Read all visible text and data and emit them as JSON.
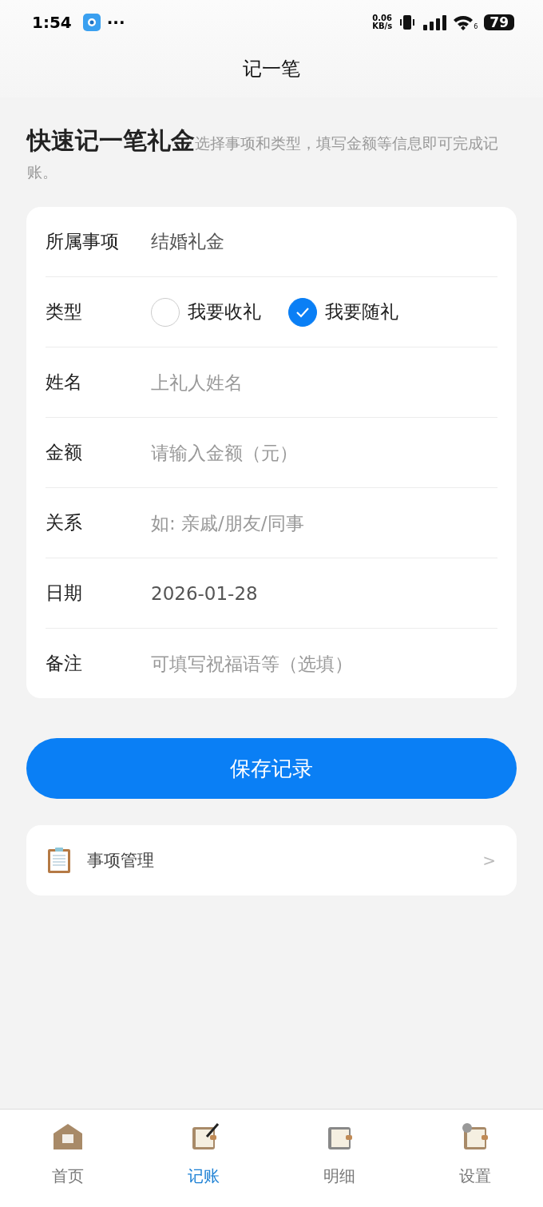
{
  "status_bar": {
    "time": "1:54",
    "more": "···",
    "net_speed": "0.06",
    "net_unit": "KB/s",
    "wifi_band": "6",
    "battery": "79"
  },
  "nav": {
    "title": "记一笔"
  },
  "intro": {
    "title": "快速记一笔礼金",
    "subtitle": "选择事项和类型，填写金额等信息即可完成记账。"
  },
  "form": [
    {
      "kind": "value",
      "label": "所属事项",
      "value": "结婚礼金"
    },
    {
      "kind": "radio",
      "label": "类型",
      "options": [
        {
          "label": "我要收礼",
          "selected": false
        },
        {
          "label": "我要随礼",
          "selected": true
        }
      ]
    },
    {
      "kind": "input",
      "label": "姓名",
      "placeholder": "上礼人姓名"
    },
    {
      "kind": "input",
      "label": "金额",
      "placeholder": "请输入金额（元）"
    },
    {
      "kind": "input",
      "label": "关系",
      "placeholder": "如: 亲戚/朋友/同事"
    },
    {
      "kind": "value",
      "label": "日期",
      "value": "2026-01-28"
    },
    {
      "kind": "input",
      "label": "备注",
      "placeholder": "可填写祝福语等（选填）"
    }
  ],
  "save_button": "保存记录",
  "manage": {
    "label": "事项管理",
    "chevron": ">"
  },
  "tabs": [
    {
      "label": "首页",
      "selected": false
    },
    {
      "label": "记账",
      "selected": true
    },
    {
      "label": "明细",
      "selected": false
    },
    {
      "label": "设置",
      "selected": false
    }
  ]
}
